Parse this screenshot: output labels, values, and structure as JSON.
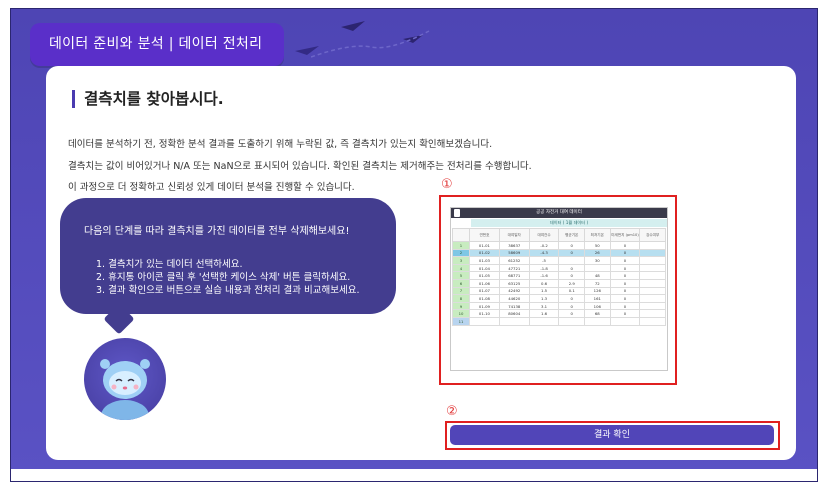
{
  "header": {
    "title": "데이터 준비와 분석  |  데이터 전처리"
  },
  "content": {
    "title": "결측치를 찾아봅시다.",
    "descriptions": [
      "데이터를 분석하기 전, 정확한 분석 결과를 도출하기 위해 누락된 값, 즉 결측치가 있는지 확인해보겠습니다.",
      "결측치는 값이 비어있거나 N/A 또는 NaN으로 표시되어 있습니다. 확인된 결측치는 제거해주는 전처리를 수행합니다.",
      "이 과정으로 더 정확하고 신뢰성 있게 데이터 분석을 진행할 수 있습니다."
    ]
  },
  "bubble": {
    "intro": "다음의 단계를 따라 결측치를 가진 데이터를 전부 삭제해보세요!",
    "steps": [
      "1. 결측치가 있는 데이터 선택하세요.",
      "2. 휴지통 아이콘 클릭 후 '선택한 케이스 삭제' 버튼 클릭하세요.",
      "3. 결과 확인으로 버튼으로 실습 내용과 전처리 결과 비교해보세요."
    ]
  },
  "markers": {
    "one": "①",
    "two": "②"
  },
  "sheet": {
    "title": "공공 자전거 대여 데이터",
    "subtitle": "데이터 ( 1월 데이터 )",
    "headers": [
      "연번호",
      "대여일자",
      "대여건수",
      "평균기온",
      "최저기온",
      "미세먼지 (pm10)",
      "강수여부"
    ],
    "rows": [
      [
        "1",
        "01-01",
        "38637",
        "-0.2",
        "0",
        "50",
        "0"
      ],
      [
        "2",
        "01-02",
        "58609",
        "-4.3",
        "0",
        "26",
        "0"
      ],
      [
        "3",
        "01-03",
        "61252",
        "-5",
        "",
        "30",
        "0"
      ],
      [
        "4",
        "01-04",
        "47721",
        "-1.8",
        "0",
        "",
        "0"
      ],
      [
        "5",
        "01-05",
        "68771",
        "-1.6",
        "0",
        "48",
        "0"
      ],
      [
        "6",
        "01-06",
        "63125",
        "0.6",
        "2.9",
        "72",
        "0"
      ],
      [
        "7",
        "01-07",
        "42492",
        "1.5",
        "0.1",
        "126",
        "0"
      ],
      [
        "8",
        "01-08",
        "44620",
        "1.3",
        "0",
        "161",
        "0"
      ],
      [
        "9",
        "01-09",
        "74138",
        "3.1",
        "0",
        "106",
        "0"
      ],
      [
        "10",
        "01-10",
        "80604",
        "1.6",
        "0",
        "68",
        "0"
      ]
    ],
    "empty_row_index": "11"
  },
  "actions": {
    "confirm_label": "결과 확인"
  }
}
